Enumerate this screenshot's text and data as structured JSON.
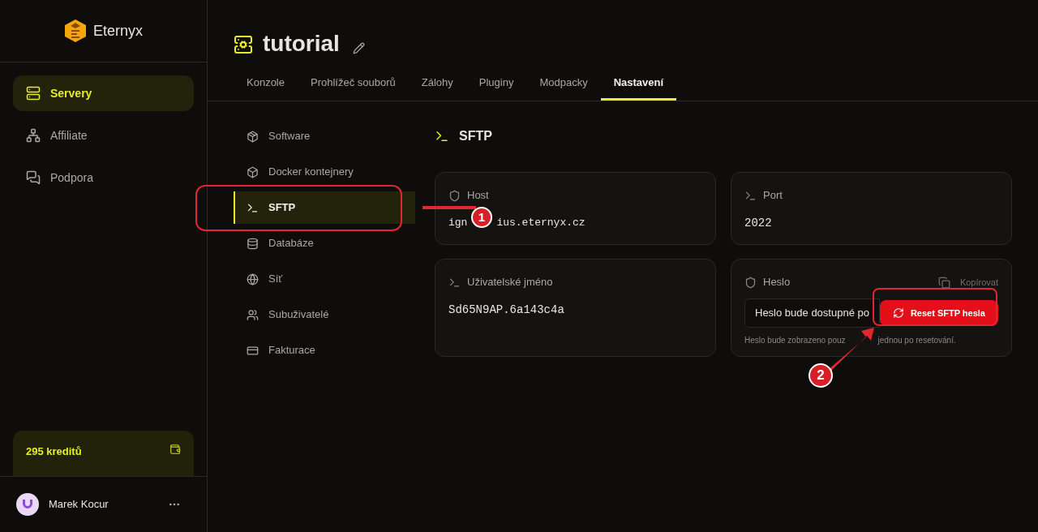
{
  "brand": {
    "name": "Eternyx"
  },
  "sidebar": {
    "items": [
      {
        "label": "Servery",
        "selected": true
      },
      {
        "label": "Affiliate",
        "selected": false
      },
      {
        "label": "Podpora",
        "selected": false
      }
    ],
    "credits": "295 kreditů",
    "user": {
      "name": "Marek Kocur"
    }
  },
  "header": {
    "title": "tutorial"
  },
  "tabs": [
    {
      "label": "Konzole",
      "selected": false
    },
    {
      "label": "Prohlížeč souborů",
      "selected": false
    },
    {
      "label": "Zálohy",
      "selected": false
    },
    {
      "label": "Pluginy",
      "selected": false
    },
    {
      "label": "Modpacky",
      "selected": false
    },
    {
      "label": "Nastavení",
      "selected": true
    }
  ],
  "settings_nav": [
    {
      "label": "Software",
      "selected": false
    },
    {
      "label": "Docker kontejnery",
      "selected": false
    },
    {
      "label": "SFTP",
      "selected": true
    },
    {
      "label": "Databáze",
      "selected": false
    },
    {
      "label": "Síť",
      "selected": false
    },
    {
      "label": "Subuživatelé",
      "selected": false
    },
    {
      "label": "Fakturace",
      "selected": false
    }
  ],
  "section": {
    "title": "SFTP",
    "host": {
      "label": "Host",
      "value_start": "ign",
      "value_end": "ius.eternyx.cz"
    },
    "port": {
      "label": "Port",
      "value": "2022"
    },
    "username": {
      "label": "Uživatelské jméno",
      "value": "Sd65N9AP.6a143c4a"
    },
    "password": {
      "label": "Heslo",
      "copy": "Kopírovat",
      "placeholder": "Heslo bude dostupné po",
      "button": "Reset SFTP hesla",
      "hint_start": "Heslo bude zobrazeno pouz",
      "hint_end": "jednou po resetování."
    }
  },
  "annotations": [
    {
      "label": "1"
    },
    {
      "label": "2"
    }
  ]
}
